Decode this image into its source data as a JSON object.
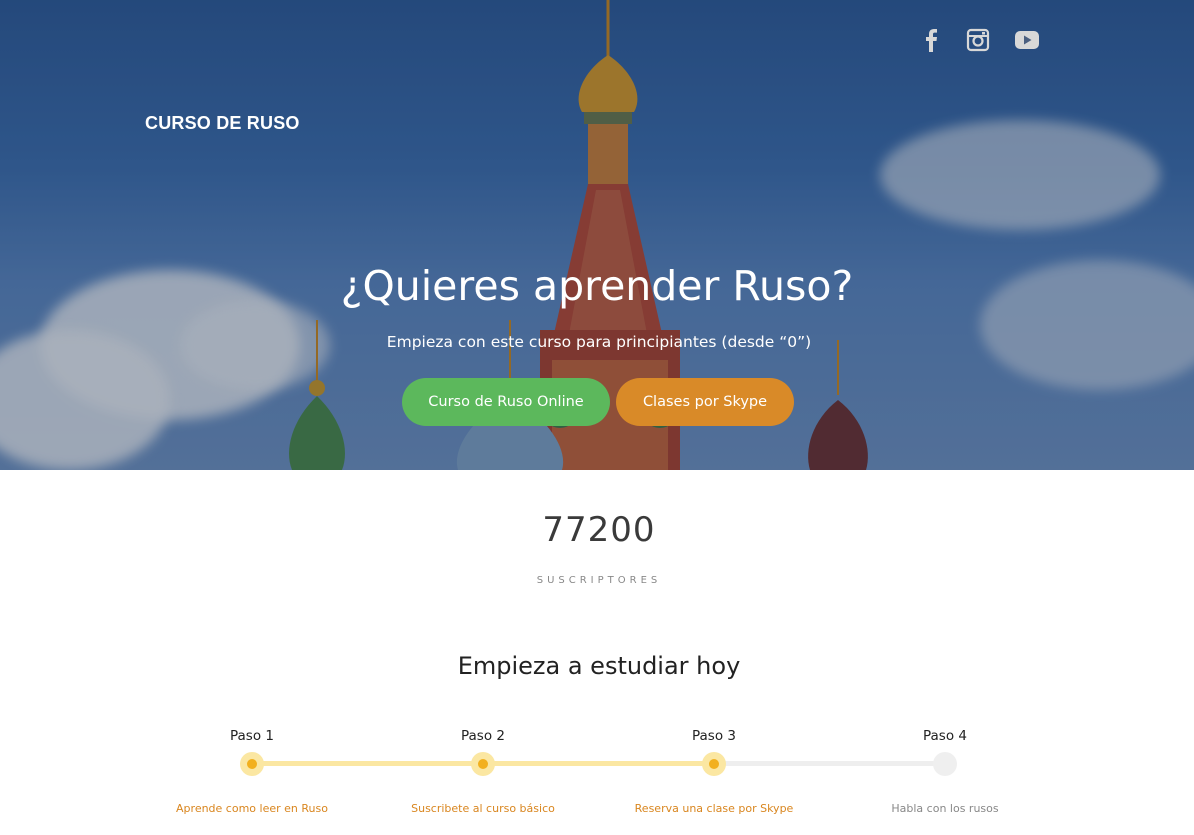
{
  "header": {
    "brand": "CURSO DE RUSO",
    "social": [
      {
        "icon": "facebook-icon"
      },
      {
        "icon": "instagram-icon"
      },
      {
        "icon": "youtube-icon"
      }
    ]
  },
  "hero": {
    "title": "¿Quieres aprender Ruso?",
    "subtitle": "Empieza con este curso para principiantes (desde “0”)",
    "primary_button": "Curso de Ruso Online",
    "secondary_button": "Clases por Skype",
    "colors": {
      "primary": "#5cb85c",
      "secondary": "#d98a28"
    }
  },
  "stats": {
    "count": "77200",
    "label": "SUSCRIPTORES"
  },
  "steps_section": {
    "title": "Empieza a estudiar hoy",
    "steps": [
      {
        "label": "Paso 1",
        "description": "Aprende como leer en Ruso",
        "completed": true
      },
      {
        "label": "Paso 2",
        "description": "Suscribete al curso básico",
        "completed": true
      },
      {
        "label": "Paso 3",
        "description": "Reserva una clase por Skype",
        "completed": true
      },
      {
        "label": "Paso 4",
        "description": "Habla con los rusos",
        "completed": false
      }
    ],
    "colors": {
      "active": "#f2b01e",
      "active_track": "#fbe7a2",
      "inactive": "#eeeeee",
      "active_text": "#d9861f"
    }
  }
}
